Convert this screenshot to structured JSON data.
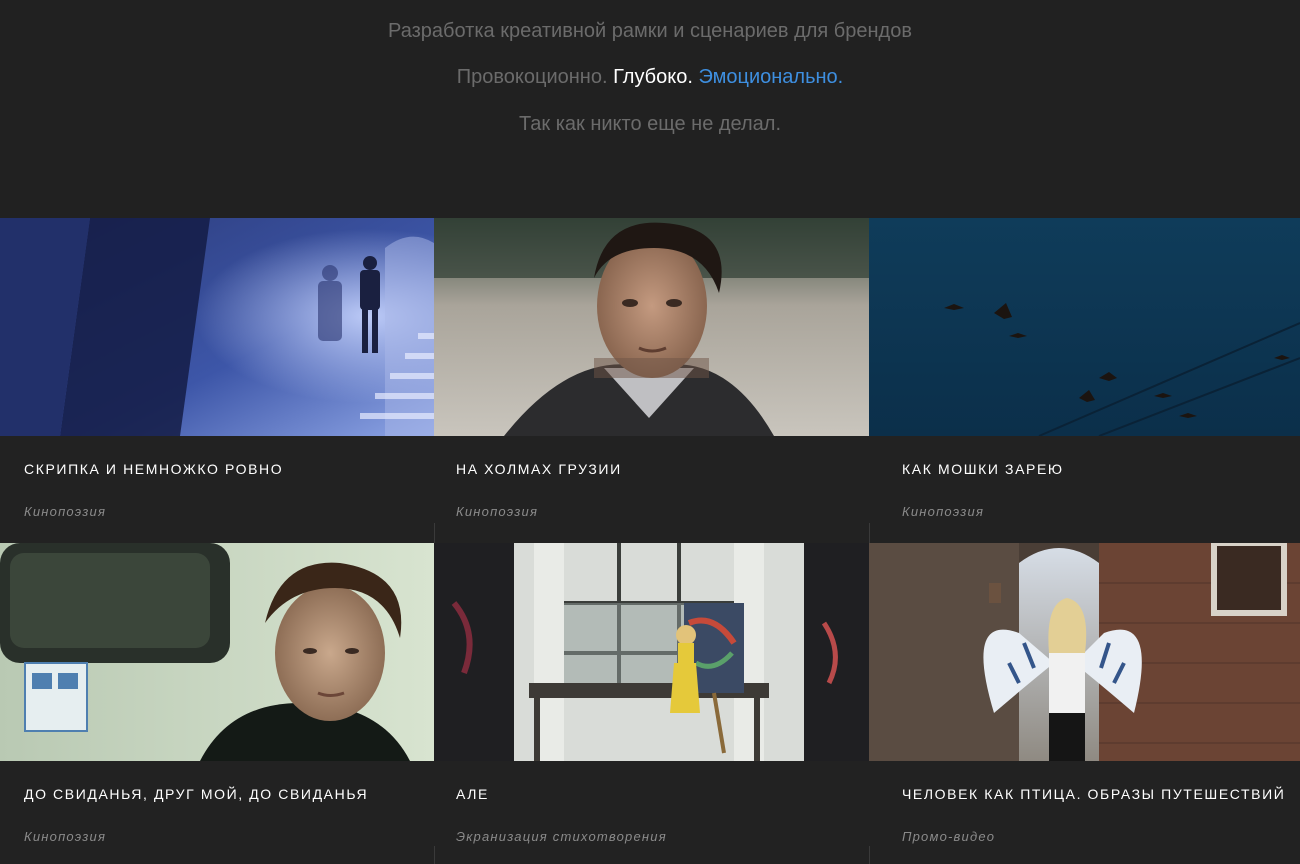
{
  "hero": {
    "heading": "Разработка креативной рамки и сценариев для брендов",
    "tagline_word_1": "Провокоционно.",
    "tagline_word_2": "Глубоко.",
    "tagline_word_3": "Эмоционально.",
    "subline": "Так как никто еще не делал."
  },
  "colors": {
    "background": "#222222",
    "accent": "#3e8fe0",
    "muted_text": "#6b6b6b"
  },
  "projects": [
    {
      "title": "СКРИПКА И НЕМНОЖКО РОВНО",
      "category": "Кинопоэзия",
      "thumbnail": "blue-stairway-silhouette"
    },
    {
      "title": "НА ХОЛМАХ ГРУЗИИ",
      "category": "Кинопоэзия",
      "thumbnail": "man-portrait-closeup"
    },
    {
      "title": "КАК МОШКИ ЗАРЕЮ",
      "category": "Кинопоэзия",
      "thumbnail": "birds-in-blue-sky"
    },
    {
      "title": "ДО СВИДАНЬЯ, ДРУГ МОЙ, ДО СВИДАНЬЯ",
      "category": "Кинопоэзия",
      "thumbnail": "man-in-train"
    },
    {
      "title": "АЛЕ",
      "category": "Экранизация стихотворения",
      "thumbnail": "girl-painting-canvas"
    },
    {
      "title": "ЧЕЛОВЕК КАК ПТИЦА. ОБРАЗЫ ПУТЕШЕСТВИЙ",
      "category": "Промо-видео",
      "thumbnail": "angel-wings-alley"
    }
  ]
}
